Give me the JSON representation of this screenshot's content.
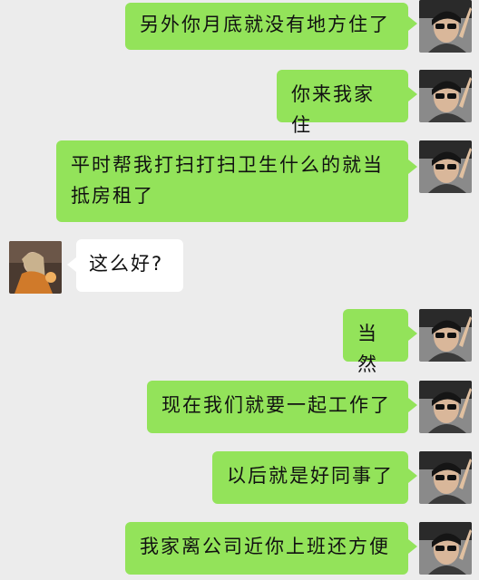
{
  "messages": [
    {
      "side": "right",
      "text": "另外你月底就没有地方住了"
    },
    {
      "side": "right",
      "text": "你来我家住"
    },
    {
      "side": "right",
      "text": "平时帮我打扫打扫卫生什么的就当抵房租了"
    },
    {
      "side": "left",
      "text": "这么好?"
    },
    {
      "side": "right",
      "text": "当然"
    },
    {
      "side": "right",
      "text": "现在我们就要一起工作了"
    },
    {
      "side": "right",
      "text": "以后就是好同事了"
    },
    {
      "side": "right",
      "text": "我家离公司近你上班还方便"
    }
  ],
  "colors": {
    "background": "#ececec",
    "sent_bubble": "#93e35a",
    "received_bubble": "#ffffff"
  }
}
